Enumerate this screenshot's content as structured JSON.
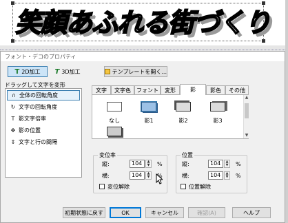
{
  "banner": {
    "title": "笑顔あふれる街づくり"
  },
  "dialog": {
    "title": "フォント・デコのプロパティ",
    "mode_buttons": {
      "two_d": "2D加工",
      "three_d": "3D加工"
    },
    "template_button": "テンプレートを開く...",
    "drag_label": "ドラッグして文字を変形",
    "left_panel": [
      {
        "icon": "rotate-all-icon",
        "label": "全体の回転角度"
      },
      {
        "icon": "rotate-char-icon",
        "label": "文字の回転角度"
      },
      {
        "icon": "shadow-scale-icon",
        "label": "影文字倍率"
      },
      {
        "icon": "shadow-position-icon",
        "label": "影の位置"
      },
      {
        "icon": "spacing-icon",
        "label": "文字と行の間隔"
      }
    ],
    "tabs": [
      "文字",
      "文字色",
      "フォント",
      "変形",
      "影",
      "影色",
      "その他"
    ],
    "active_tab": "影",
    "shadow_options": [
      "なし",
      "影1",
      "影2",
      "影3",
      ""
    ],
    "scale_group": {
      "title": "変位率",
      "vertical_label": "縦:",
      "vertical_value": "104",
      "horizontal_label": "横:",
      "horizontal_value": "104",
      "unit": "%",
      "unlink_label": "変位解除"
    },
    "position_group": {
      "title": "位置",
      "vertical_label": "縦:",
      "vertical_value": "104",
      "horizontal_label": "横:",
      "horizontal_value": "104",
      "unit": "%",
      "unlink_label": "位置解除"
    },
    "footer": {
      "reset": "初期状態に戻す",
      "ok": "OK",
      "cancel": "キャンセル",
      "confirm": "確認(A)",
      "help": "ヘルプ"
    }
  },
  "colors": {
    "accent": "#0078d7",
    "selected_bg": "#cce4f7",
    "icon_green": "#1a7a2a"
  }
}
